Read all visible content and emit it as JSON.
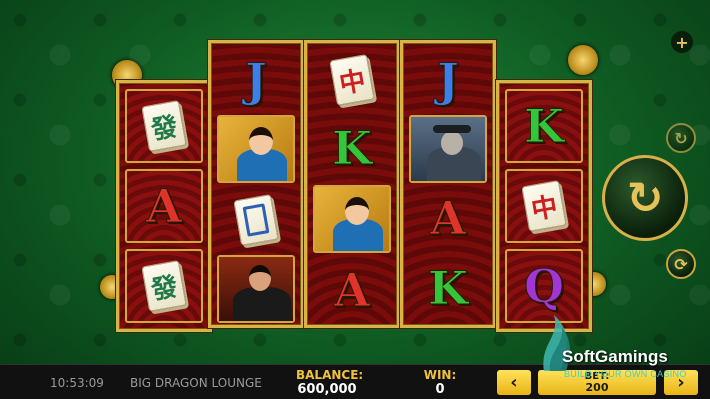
{
  "game": {
    "reels": [
      [
        "mahjong-green-dragon",
        "A",
        "mahjong-green-dragon"
      ],
      [
        "J",
        "woman-portrait",
        "mahjong-white-dragon",
        "man-portrait"
      ],
      [
        "mahjong-red-dragon",
        "K",
        "woman-portrait",
        "A"
      ],
      [
        "J",
        "detective-portrait",
        "A",
        "K"
      ],
      [
        "K",
        "mahjong-red-dragon",
        "Q"
      ]
    ],
    "symbol_glyphs": {
      "green_dragon": "發",
      "red_dragon": "中"
    },
    "letters": {
      "A": "A",
      "J": "J",
      "K": "K",
      "Q": "Q"
    }
  },
  "controls": {
    "plus_icon": "plus-icon",
    "spin_icon": "spin-arrow-icon",
    "autoplay_icon": "autoplay-icon",
    "turbo_icon": "turbo-icon"
  },
  "bottom_bar": {
    "time": "10:53:09",
    "game_name": "BIG DRAGON LOUNGE",
    "balance_label": "BALANCE:",
    "balance_value": "600,000",
    "win_label": "WIN:",
    "win_value": "0",
    "bet_label": "BET:",
    "bet_value": "200",
    "bet_decrease": "‹",
    "bet_increase": "›"
  },
  "watermark": {
    "brand": "SoftGamings",
    "tagline": "BUILD YOUR OWN CASINO"
  },
  "colors": {
    "felt_green": "#1f8a3a",
    "reel_red": "#7a0c0c",
    "gold": "#d9b24a",
    "button_yellow": "#f0c23a"
  }
}
